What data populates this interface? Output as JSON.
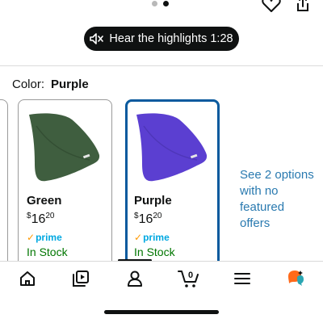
{
  "carousel": {
    "dots": 2,
    "active_index": 1
  },
  "header_icons": [
    "heart-icon",
    "share-icon"
  ],
  "highlights": {
    "label": "Hear the highlights 1:28",
    "icon": "speaker-icon"
  },
  "color": {
    "label": "Color:",
    "selected": "Purple"
  },
  "variants": [
    {
      "name": "Green",
      "price_symbol": "$",
      "price_whole": "16",
      "price_fraction": "20",
      "prime": "prime",
      "stock": "In Stock",
      "swatch_color": "#3f5e3f",
      "selected": false
    },
    {
      "name": "Purple",
      "price_symbol": "$",
      "price_whole": "16",
      "price_fraction": "20",
      "prime": "prime",
      "stock": "In Stock",
      "swatch_color": "#5b3fd1",
      "selected": true
    }
  ],
  "see_options": "See 2 options with no featured offers",
  "bottom_nav": [
    "home-icon",
    "video-icon",
    "account-icon",
    "cart-icon",
    "menu-icon",
    "assistant-icon"
  ],
  "cart": {
    "count": "0"
  },
  "colors": {
    "accent_blue": "#0a5a9e",
    "link": "#2a7ab0",
    "in_stock": "#007600",
    "prime": "#00a8e1",
    "prime_check": "#ff9900"
  }
}
